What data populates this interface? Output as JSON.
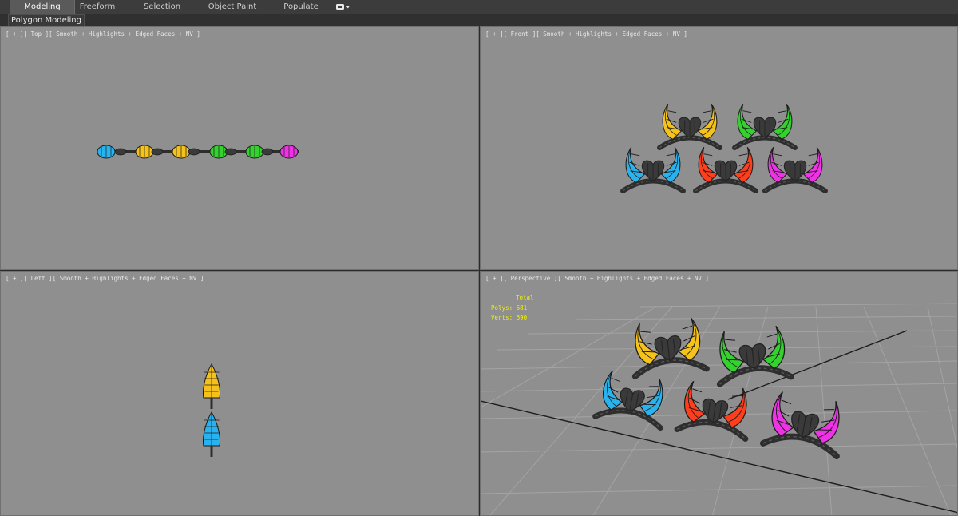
{
  "ribbon": {
    "tabs": [
      {
        "label": "Modeling"
      },
      {
        "label": "Freeform"
      },
      {
        "label": "Selection"
      },
      {
        "label": "Object Paint"
      },
      {
        "label": "Populate"
      }
    ]
  },
  "subtab": {
    "label": "Polygon Modeling"
  },
  "viewports": {
    "top": {
      "label": "[ + ][ Top ][ Smooth + Highlights + Edged Faces + NV ]"
    },
    "front": {
      "label": "[ + ][ Front ][ Smooth + Highlights + Edged Faces + NV ]"
    },
    "left": {
      "label": "[ + ][ Left ][ Smooth + Highlights + Edged Faces + NV ]"
    },
    "perspective": {
      "label": "[ + ][ Perspective ][ Smooth + Highlights + Edged Faces + NV ]",
      "stats": {
        "total": "Total",
        "polys": "Polys: 681",
        "verts": "Verts: 690"
      }
    }
  },
  "colors": {
    "viewport_bg": "#8f8f8f",
    "band": "#2e2e2e",
    "heart": "#3a3a3a",
    "stats_text": "#f2f200",
    "horn_yellow": "#f5c21b",
    "horn_green": "#35d12f",
    "horn_blue": "#29b3ee",
    "horn_red": "#ff3e1c",
    "horn_magenta": "#ef32e6"
  },
  "models": [
    {
      "name": "horns-yellow",
      "color": "#f5c21b"
    },
    {
      "name": "horns-green",
      "color": "#35d12f"
    },
    {
      "name": "horns-blue",
      "color": "#29b3ee"
    },
    {
      "name": "horns-red",
      "color": "#ff3e1c"
    },
    {
      "name": "horns-magenta",
      "color": "#ef32e6"
    }
  ]
}
